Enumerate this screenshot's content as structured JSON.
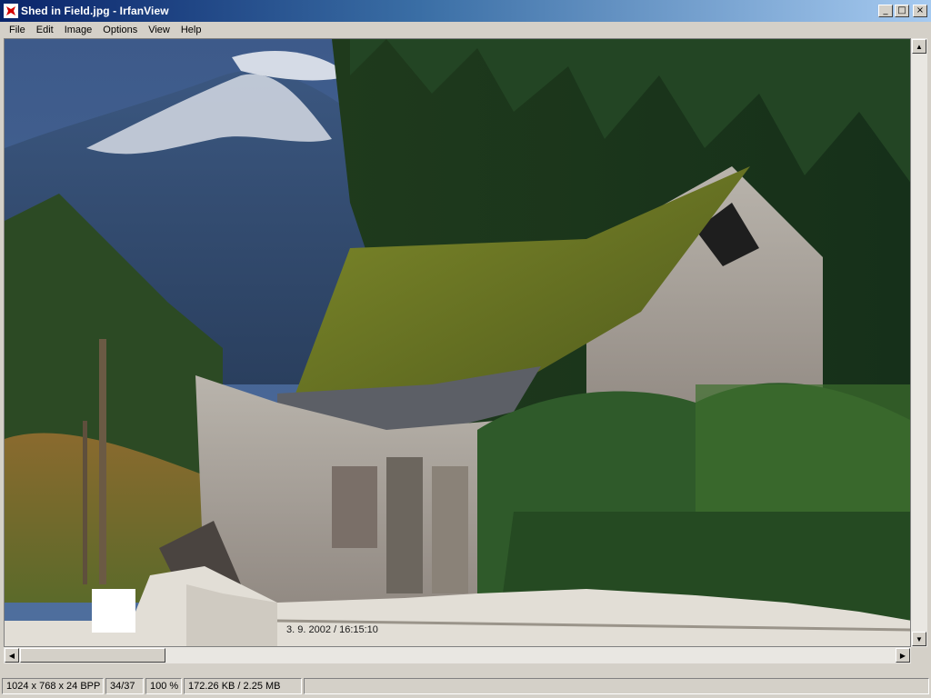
{
  "window": {
    "title": "Shed in Field.jpg - IrfanView",
    "buttons": {
      "minimize": "_",
      "maximize": "□",
      "close": "×"
    }
  },
  "menu": [
    "File",
    "Edit",
    "Image",
    "Options",
    "View",
    "Help"
  ],
  "image": {
    "filename": "Shed in Field.jpg",
    "overlay_date": "3. 9. 2002 / 16:15:10"
  },
  "status": {
    "dimensions": "1024 x 768 x 24 BPP",
    "index": "34/37",
    "zoom": "100 %",
    "filesize": "172.26 KB / 2.25 MB"
  },
  "icons": {
    "app": "irfanview-red-cat-icon",
    "scroll_up": "arrow-up-icon",
    "scroll_down": "arrow-down-icon",
    "scroll_left": "arrow-left-icon",
    "scroll_right": "arrow-right-icon"
  },
  "colors": {
    "titlebar_start": "#0a246a",
    "titlebar_end": "#a6caf0",
    "chrome": "#d4d0c8"
  }
}
